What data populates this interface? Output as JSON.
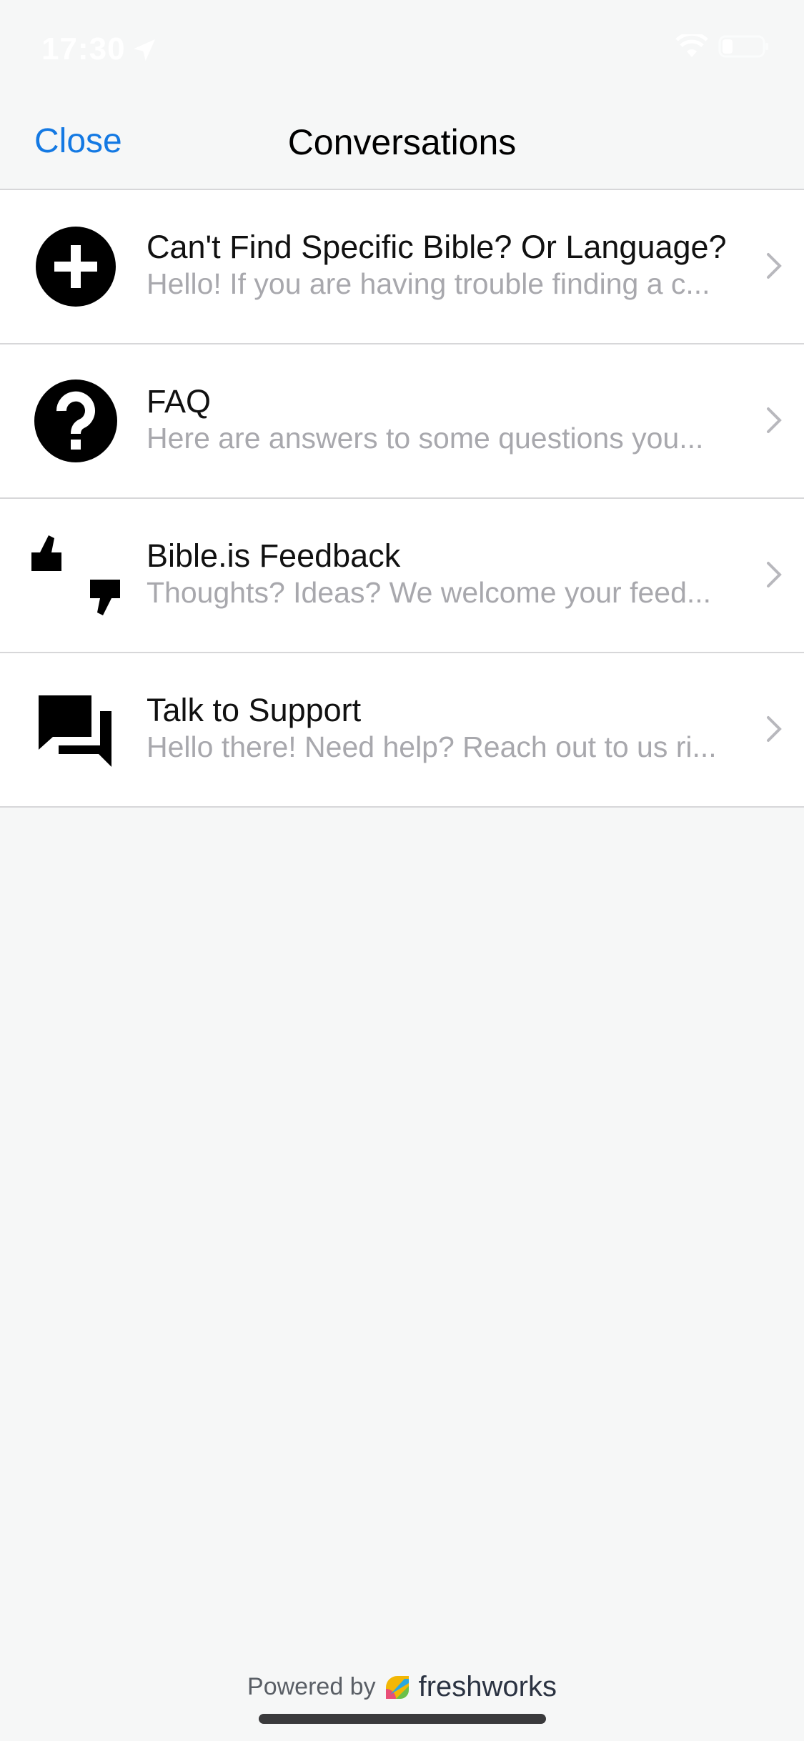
{
  "status_bar": {
    "time": "17:30"
  },
  "nav": {
    "close_label": "Close",
    "title": "Conversations"
  },
  "conversations": [
    {
      "title": "Can't Find Specific Bible? Or Language?",
      "preview": "Hello! If you are having trouble finding a c...",
      "icon": "plus-circle-icon"
    },
    {
      "title": "FAQ",
      "preview": "Here are answers to some questions you...",
      "icon": "question-circle-icon"
    },
    {
      "title": "Bible.is Feedback",
      "preview": "Thoughts? Ideas? We welcome your feed...",
      "icon": "thumbs-up-down-icon"
    },
    {
      "title": "Talk to Support",
      "preview": "Hello there! Need help? Reach out to us ri...",
      "icon": "chat-bubbles-icon"
    }
  ],
  "footer": {
    "powered_by": "Powered by",
    "brand": "freshworks"
  },
  "colors": {
    "accent": "#1479e3",
    "background": "#f6f7f7",
    "separator": "#d7d7d9",
    "subtitle": "#a8a8ad"
  }
}
